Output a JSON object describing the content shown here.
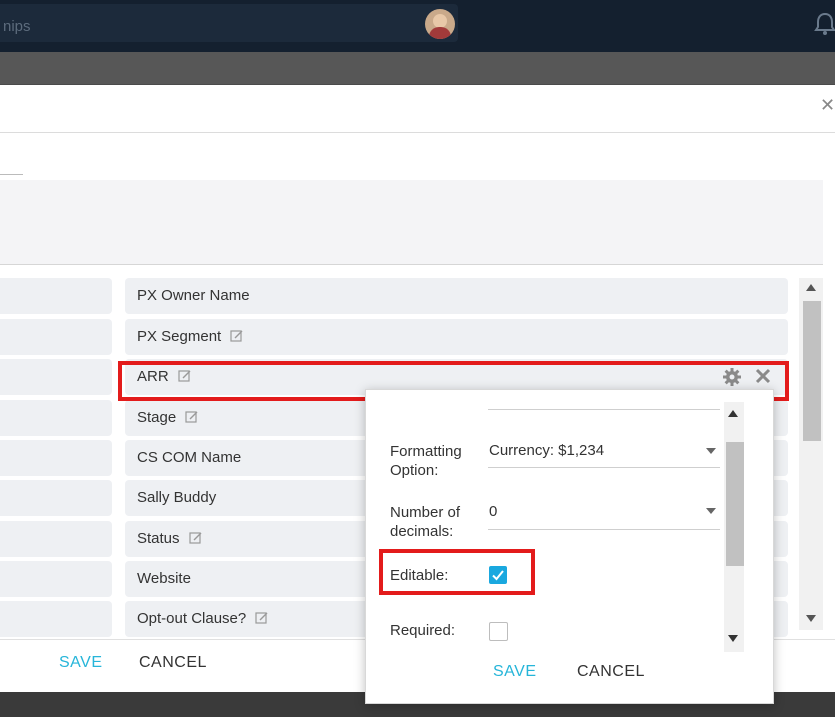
{
  "topbar": {
    "search_text": "nips"
  },
  "field_rows": [
    {
      "label": "PX Owner Name",
      "editable": false
    },
    {
      "label": "PX Segment",
      "editable": true
    },
    {
      "label": "ARR",
      "editable": true
    },
    {
      "label": "Stage",
      "editable": true
    },
    {
      "label": "CS COM Name",
      "editable": false
    },
    {
      "label": "Sally Buddy",
      "editable": false
    },
    {
      "label": "Status",
      "editable": true
    },
    {
      "label": "Website",
      "editable": false
    },
    {
      "label": "Opt-out Clause?",
      "editable": true
    }
  ],
  "footer": {
    "save_label": "SAVE",
    "cancel_label": "CANCEL"
  },
  "popover": {
    "formatting_label": "Formatting Option:",
    "formatting_value": "Currency: $1,234",
    "decimals_label": "Number of decimals:",
    "decimals_value": "0",
    "editable_label": "Editable:",
    "editable_checked": true,
    "required_label": "Required:",
    "required_checked": false,
    "save_label": "SAVE",
    "cancel_label": "CANCEL"
  },
  "colors": {
    "accent": "#26b5d9",
    "highlight": "#e31b1b",
    "checkbox": "#1aa8df"
  }
}
